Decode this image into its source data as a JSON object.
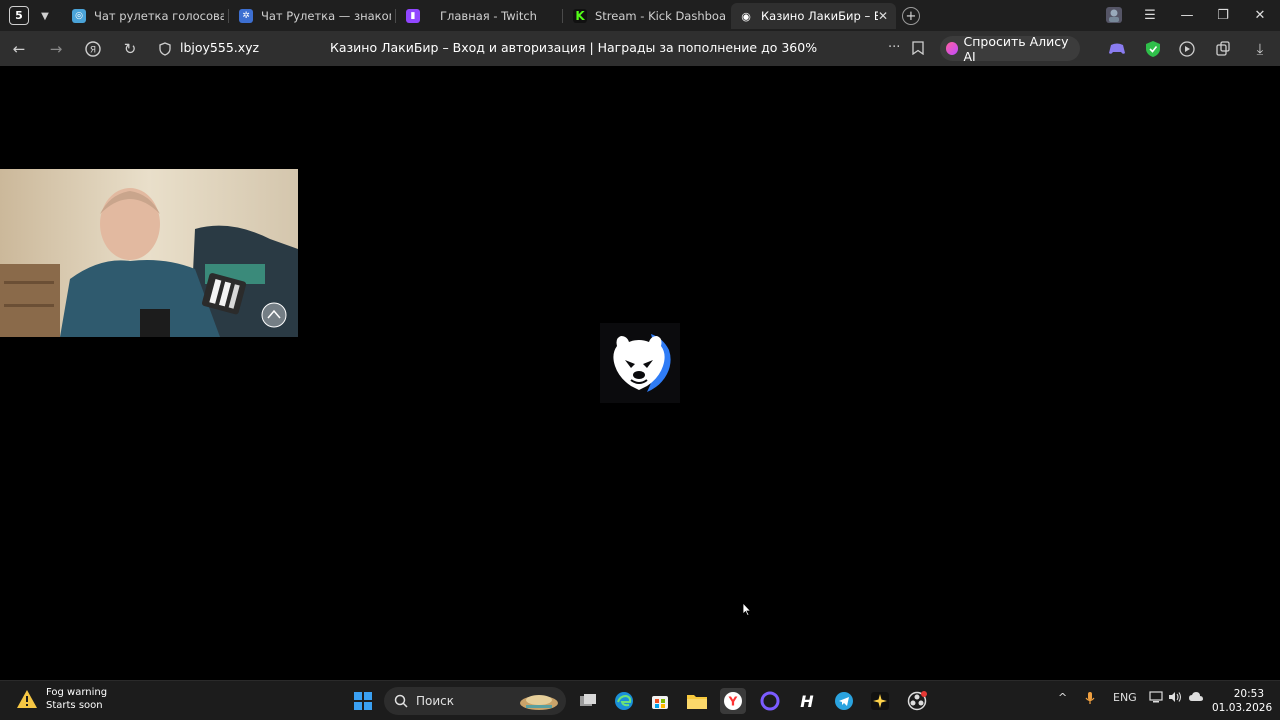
{
  "browser": {
    "tab_count": "5",
    "tabs": [
      {
        "title": "Чат рулетка голосовая –"
      },
      {
        "title": "Чат Рулетка — знакомств"
      },
      {
        "title": "Главная - Twitch"
      },
      {
        "title": "Stream - Kick Dashboard"
      },
      {
        "title": "Казино ЛакиБир – Вход"
      }
    ],
    "address": {
      "domain": "lbjoy555.xyz",
      "page_title": "Казино ЛакиБир – Вход и авторизация | Награды за пополнение до 360%"
    },
    "alice_label": "Спросить Алису AI"
  },
  "taskbar": {
    "weather": {
      "title": "Fog warning",
      "subtitle": "Starts soon"
    },
    "search_placeholder": "Поиск",
    "language": "ENG",
    "time": "20:53",
    "date": "01.03.2026"
  },
  "colors": {
    "twitch": "#9146ff",
    "kick": "#53fc18",
    "accent_blue": "#2f7cf6"
  }
}
